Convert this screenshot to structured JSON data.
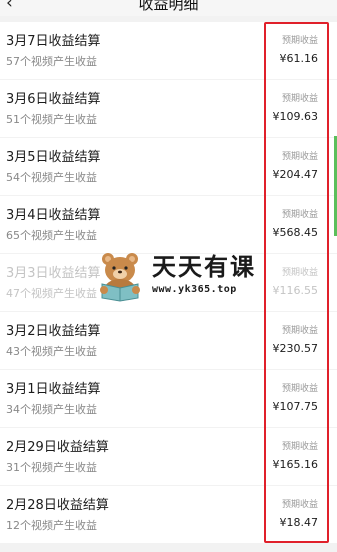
{
  "header": {
    "back_icon": "chevron-left-icon",
    "back_glyph": "‹",
    "title": "收益明细"
  },
  "items": [
    {
      "title": "3月7日收益结算",
      "subtitle": "57个视频产生收益",
      "label": "预期收益",
      "amount": "¥61.16"
    },
    {
      "title": "3月6日收益结算",
      "subtitle": "51个视频产生收益",
      "label": "预期收益",
      "amount": "¥109.63"
    },
    {
      "title": "3月5日收益结算",
      "subtitle": "54个视频产生收益",
      "label": "预期收益",
      "amount": "¥204.47"
    },
    {
      "title": "3月4日收益结算",
      "subtitle": "65个视频产生收益",
      "label": "预期收益",
      "amount": "¥568.45"
    },
    {
      "title": "3月3日收益结算",
      "subtitle": "47个视频产生收益",
      "label": "预期收益",
      "amount": "¥116.55"
    },
    {
      "title": "3月2日收益结算",
      "subtitle": "43个视频产生收益",
      "label": "预期收益",
      "amount": "¥230.57"
    },
    {
      "title": "3月1日收益结算",
      "subtitle": "34个视频产生收益",
      "label": "预期收益",
      "amount": "¥107.75"
    },
    {
      "title": "2月29日收益结算",
      "subtitle": "31个视频产生收益",
      "label": "预期收益",
      "amount": "¥165.16"
    },
    {
      "title": "2月28日收益结算",
      "subtitle": "12个视频产生收益",
      "label": "预期收益",
      "amount": "¥18.47"
    }
  ],
  "watermark": {
    "text": "天天有课",
    "url": "www.yk365.top",
    "icon": "bear-reading-icon"
  },
  "colors": {
    "highlight": "#e0202a",
    "scroll_indicator": "#5bbf5b"
  }
}
